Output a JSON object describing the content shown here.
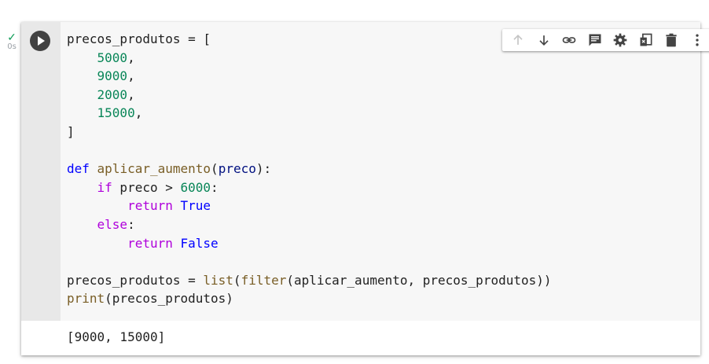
{
  "cell": {
    "status": {
      "check_glyph": "✓",
      "exec_time": "0s",
      "check_color": "#0f9d58"
    },
    "run_button": {
      "icon": "play-icon"
    },
    "code_lines": [
      [
        {
          "t": "precos_produtos = [",
          "c": ""
        }
      ],
      [
        {
          "t": "    ",
          "c": ""
        },
        {
          "t": "5000",
          "c": "num"
        },
        {
          "t": ",",
          "c": ""
        }
      ],
      [
        {
          "t": "    ",
          "c": ""
        },
        {
          "t": "9000",
          "c": "num"
        },
        {
          "t": ",",
          "c": ""
        }
      ],
      [
        {
          "t": "    ",
          "c": ""
        },
        {
          "t": "2000",
          "c": "num"
        },
        {
          "t": ",",
          "c": ""
        }
      ],
      [
        {
          "t": "    ",
          "c": ""
        },
        {
          "t": "15000",
          "c": "num"
        },
        {
          "t": ",",
          "c": ""
        }
      ],
      [
        {
          "t": "]",
          "c": ""
        }
      ],
      [],
      [
        {
          "t": "def",
          "c": "kw"
        },
        {
          "t": " ",
          "c": ""
        },
        {
          "t": "aplicar_aumento",
          "c": "fn"
        },
        {
          "t": "(",
          "c": ""
        },
        {
          "t": "preco",
          "c": "param"
        },
        {
          "t": "):",
          "c": ""
        }
      ],
      [
        {
          "t": "    ",
          "c": ""
        },
        {
          "t": "if",
          "c": "ctl"
        },
        {
          "t": " preco > ",
          "c": ""
        },
        {
          "t": "6000",
          "c": "num"
        },
        {
          "t": ":",
          "c": ""
        }
      ],
      [
        {
          "t": "        ",
          "c": ""
        },
        {
          "t": "return",
          "c": "ctl"
        },
        {
          "t": " ",
          "c": ""
        },
        {
          "t": "True",
          "c": "kw"
        }
      ],
      [
        {
          "t": "    ",
          "c": ""
        },
        {
          "t": "else",
          "c": "ctl"
        },
        {
          "t": ":",
          "c": ""
        }
      ],
      [
        {
          "t": "        ",
          "c": ""
        },
        {
          "t": "return",
          "c": "ctl"
        },
        {
          "t": " ",
          "c": ""
        },
        {
          "t": "False",
          "c": "kw"
        }
      ],
      [],
      [
        {
          "t": "precos_produtos = ",
          "c": ""
        },
        {
          "t": "list",
          "c": "fn"
        },
        {
          "t": "(",
          "c": ""
        },
        {
          "t": "filter",
          "c": "fn"
        },
        {
          "t": "(aplicar_aumento, precos_produtos))",
          "c": ""
        }
      ],
      [
        {
          "t": "print",
          "c": "fn"
        },
        {
          "t": "(precos_produtos)",
          "c": ""
        }
      ]
    ],
    "output_text": "[9000, 15000]"
  },
  "toolbar": {
    "buttons": [
      {
        "name": "move-up-button",
        "icon": "arrow-up-icon",
        "disabled": true
      },
      {
        "name": "move-down-button",
        "icon": "arrow-down-icon",
        "disabled": false
      },
      {
        "name": "copy-link-button",
        "icon": "link-icon",
        "disabled": false
      },
      {
        "name": "add-comment-button",
        "icon": "comment-icon",
        "disabled": false
      },
      {
        "name": "settings-button",
        "icon": "gear-icon",
        "disabled": false
      },
      {
        "name": "mirror-cell-button",
        "icon": "mirror-cell-icon",
        "disabled": false
      },
      {
        "name": "delete-cell-button",
        "icon": "trash-icon",
        "disabled": false
      },
      {
        "name": "more-actions-button",
        "icon": "more-vert-icon",
        "disabled": false
      }
    ]
  }
}
